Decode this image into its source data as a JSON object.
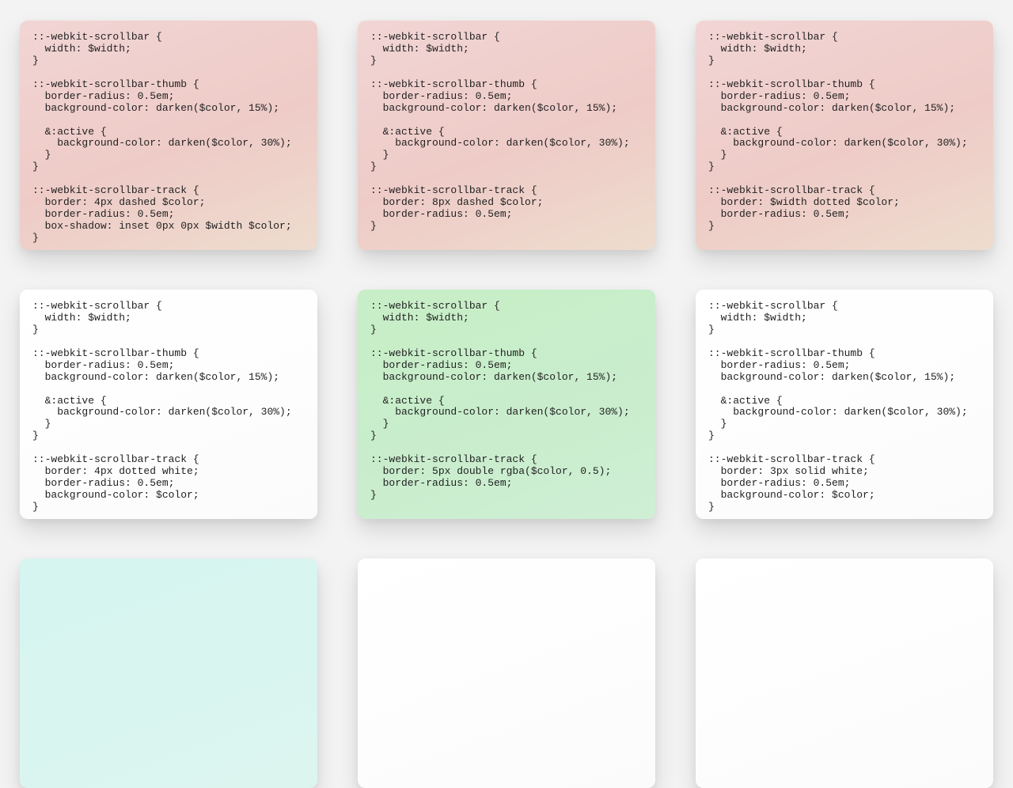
{
  "cards": [
    {
      "color": "red",
      "code": "::-webkit-scrollbar {\n  width: $width;\n}\n\n::-webkit-scrollbar-thumb {\n  border-radius: 0.5em;\n  background-color: darken($color, 15%);\n\n  &:active {\n    background-color: darken($color, 30%);\n  }\n}\n\n::-webkit-scrollbar-track {\n  border: 4px dashed $color;\n  border-radius: 0.5em;\n  box-shadow: inset 0px 0px $width $color;\n}"
    },
    {
      "color": "red",
      "code": "::-webkit-scrollbar {\n  width: $width;\n}\n\n::-webkit-scrollbar-thumb {\n  border-radius: 0.5em;\n  background-color: darken($color, 15%);\n\n  &:active {\n    background-color: darken($color, 30%);\n  }\n}\n\n::-webkit-scrollbar-track {\n  border: 8px dashed $color;\n  border-radius: 0.5em;\n}"
    },
    {
      "color": "red",
      "code": "::-webkit-scrollbar {\n  width: $width;\n}\n\n::-webkit-scrollbar-thumb {\n  border-radius: 0.5em;\n  background-color: darken($color, 15%);\n\n  &:active {\n    background-color: darken($color, 30%);\n  }\n}\n\n::-webkit-scrollbar-track {\n  border: $width dotted $color;\n  border-radius: 0.5em;\n}"
    },
    {
      "color": "white",
      "code": "::-webkit-scrollbar {\n  width: $width;\n}\n\n::-webkit-scrollbar-thumb {\n  border-radius: 0.5em;\n  background-color: darken($color, 15%);\n\n  &:active {\n    background-color: darken($color, 30%);\n  }\n}\n\n::-webkit-scrollbar-track {\n  border: 4px dotted white;\n  border-radius: 0.5em;\n  background-color: $color;\n}"
    },
    {
      "color": "green",
      "code": "::-webkit-scrollbar {\n  width: $width;\n}\n\n::-webkit-scrollbar-thumb {\n  border-radius: 0.5em;\n  background-color: darken($color, 15%);\n\n  &:active {\n    background-color: darken($color, 30%);\n  }\n}\n\n::-webkit-scrollbar-track {\n  border: 5px double rgba($color, 0.5);\n  border-radius: 0.5em;\n}"
    },
    {
      "color": "white",
      "code": "::-webkit-scrollbar {\n  width: $width;\n}\n\n::-webkit-scrollbar-thumb {\n  border-radius: 0.5em;\n  background-color: darken($color, 15%);\n\n  &:active {\n    background-color: darken($color, 30%);\n  }\n}\n\n::-webkit-scrollbar-track {\n  border: 3px solid white;\n  border-radius: 0.5em;\n  background-color: $color;\n}"
    },
    {
      "color": "teal",
      "code": ""
    },
    {
      "color": "white",
      "code": ""
    },
    {
      "color": "white",
      "code": ""
    }
  ],
  "colors": {
    "page_bg": "#f3f3f3",
    "red": "#f0d2cf",
    "green": "#c8eecc",
    "white": "#ffffff",
    "teal": "#d7f5f0"
  }
}
